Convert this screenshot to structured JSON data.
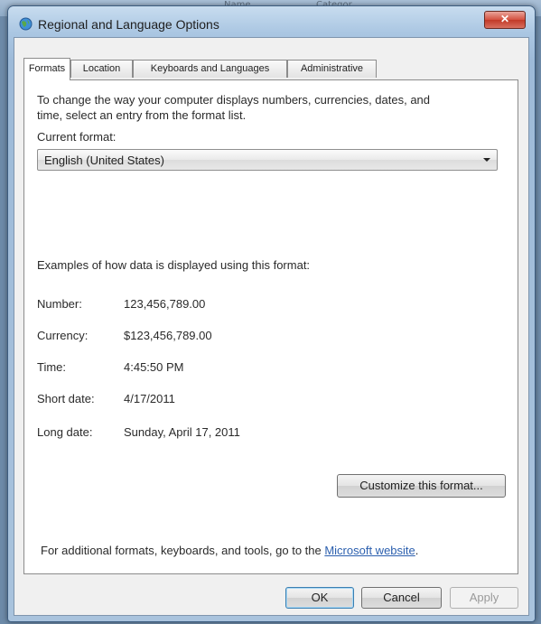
{
  "background": {
    "col1": "Name",
    "col2": "Categor"
  },
  "window": {
    "title": "Regional and Language Options",
    "close_glyph": "✕"
  },
  "tabs": [
    {
      "label": "Formats"
    },
    {
      "label": "Location"
    },
    {
      "label": "Keyboards and Languages"
    },
    {
      "label": "Administrative"
    }
  ],
  "formats": {
    "instruction": "To change the way your computer displays numbers, currencies, dates, and time, select an entry from the format list.",
    "instruction_line1": "To change the way your computer displays numbers, currencies, dates, and",
    "instruction_line2": "time, select an entry from the format list.",
    "current_format_label": "Current format:",
    "current_format_value": "English (United States)",
    "examples_heading": "Examples of how data is displayed using this format:",
    "examples": [
      {
        "label": "Number:",
        "value": "123,456,789.00"
      },
      {
        "label": "Currency:",
        "value": "$123,456,789.00"
      },
      {
        "label": "Time:",
        "value": "4:45:50 PM"
      },
      {
        "label": "Short date:",
        "value": "4/17/2011"
      },
      {
        "label": "Long date:",
        "value": "Sunday, April 17, 2011"
      }
    ],
    "customize_button": "Customize this format...",
    "footer_prefix": "For additional formats, keyboards, and tools, go to the ",
    "footer_link": "Microsoft website",
    "footer_suffix": "."
  },
  "buttons": {
    "ok": "OK",
    "cancel": "Cancel",
    "apply": "Apply"
  },
  "colors": {
    "link": "#2b5fae",
    "close_button": "#c13a28",
    "title_bar": "#aac6e2"
  }
}
